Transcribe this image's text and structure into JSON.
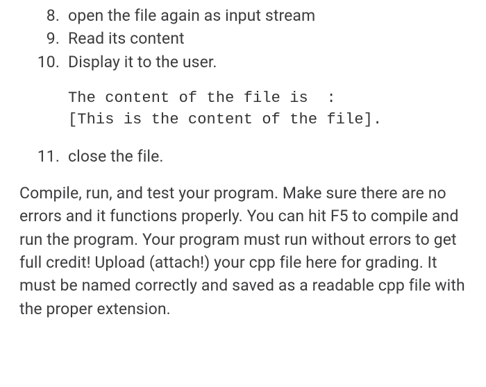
{
  "steps": [
    {
      "n": "8.",
      "text": "open the file again as input stream"
    },
    {
      "n": "9.",
      "text": "Read its content"
    },
    {
      "n": "10.",
      "text": "Display it to the user."
    }
  ],
  "code_block": "The content of the file is  :\n[This is the content of the file].",
  "steps_after": [
    {
      "n": "11.",
      "text": "close the file."
    }
  ],
  "paragraph": "Compile, run, and test your program. Make sure there are no errors and it functions properly. You can hit F5 to compile and run the program. Your program must run without errors to get full credit! Upload (attach!) your cpp file here for grading. It must be named correctly and saved as a readable cpp file with the proper extension."
}
